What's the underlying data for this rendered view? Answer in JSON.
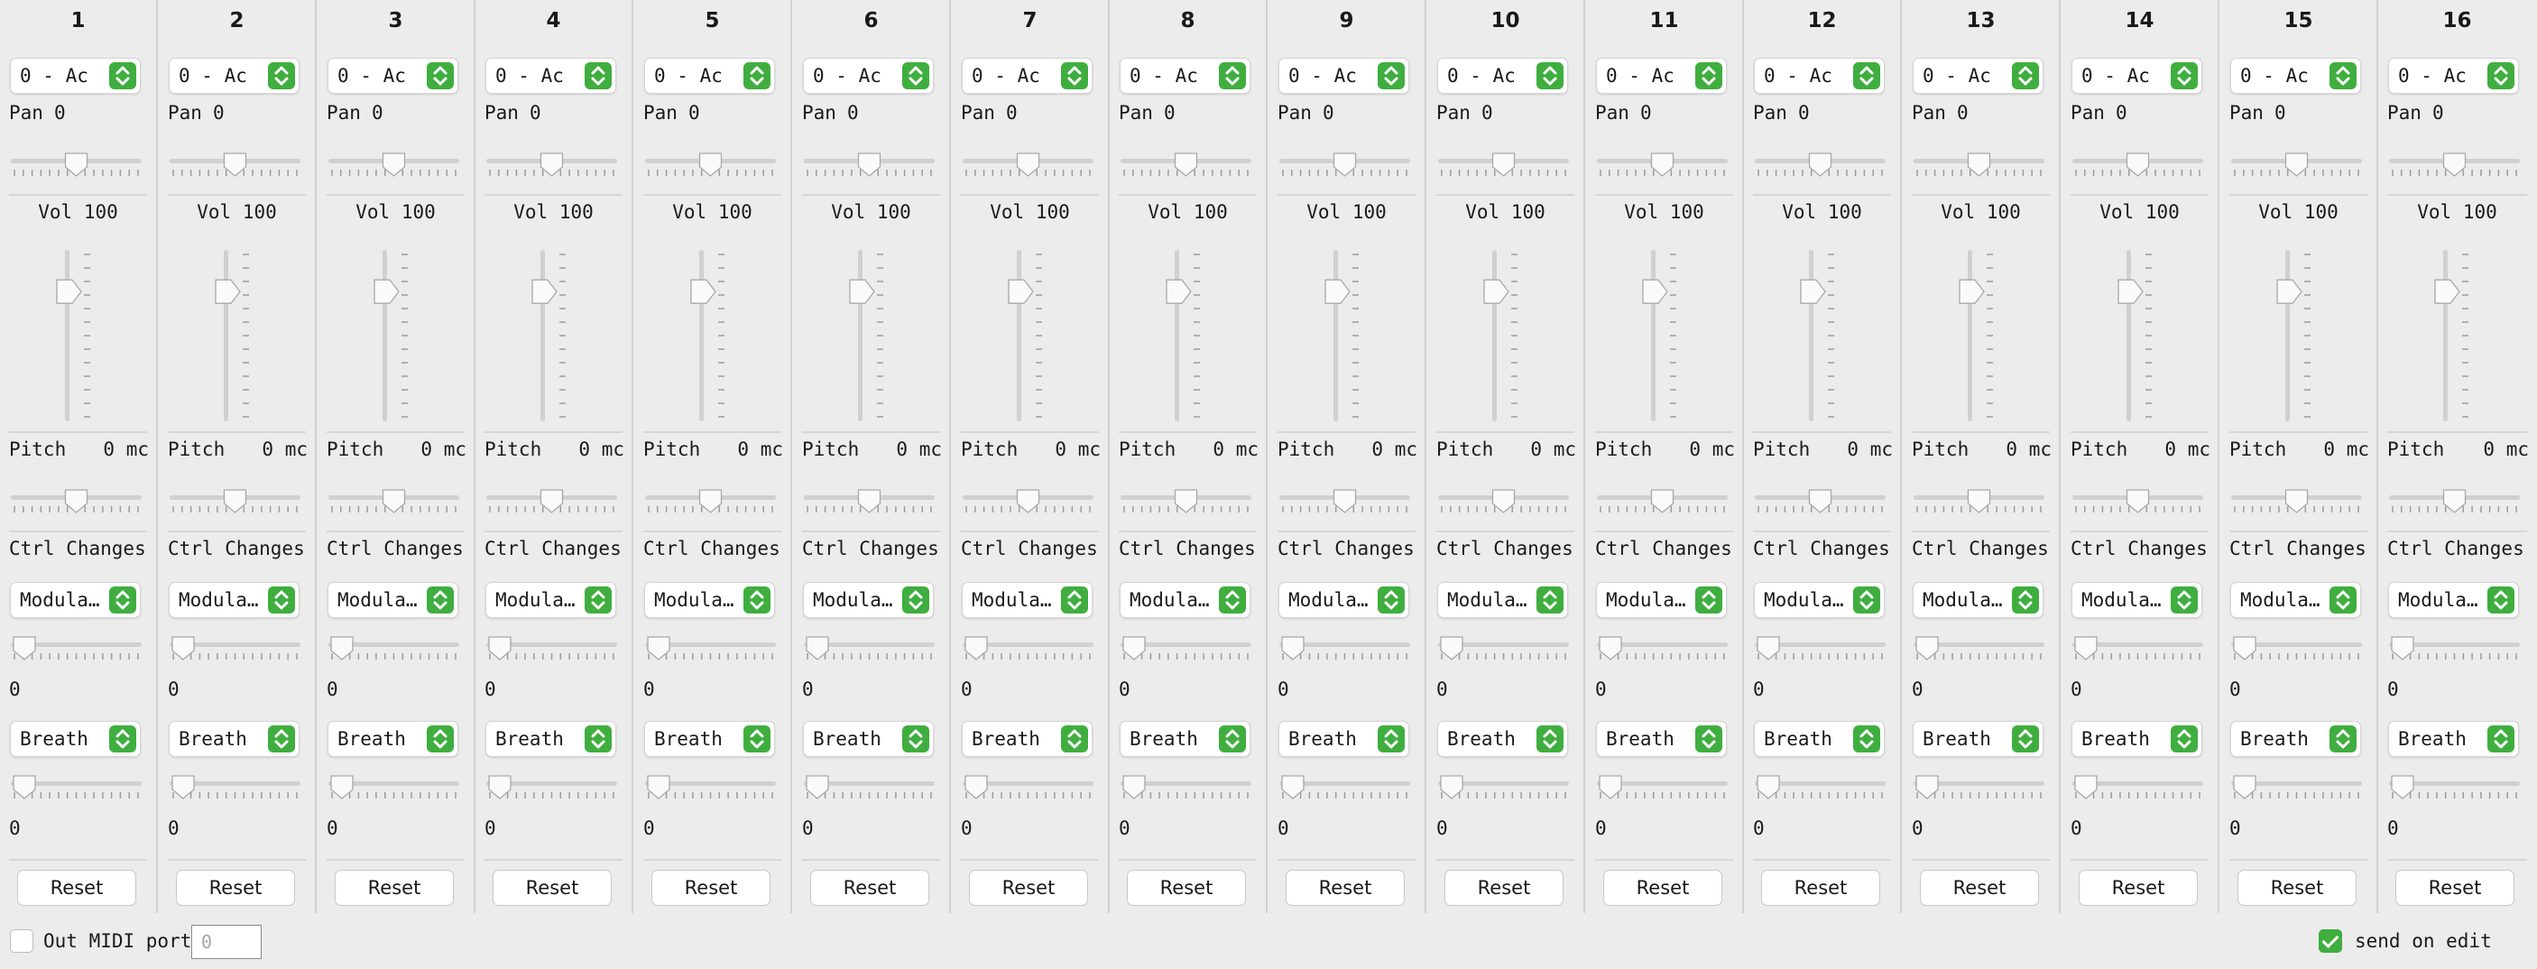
{
  "channels": [
    {
      "number": "1",
      "program": "0 - Ac",
      "pan_label": "Pan",
      "pan_value": "0",
      "pan_level": 0.5,
      "vol_label": "Vol",
      "vol_value": "100",
      "vol_level": 0.787,
      "pitch_label": "Pitch",
      "pitch_value": "0 mc",
      "pitch_level": 0.5,
      "ctrl_label": "Ctrl Changes",
      "ctrl1_name": "Modulation",
      "ctrl1_value": "0",
      "ctrl1_level": 0,
      "ctrl2_name": "Breath",
      "ctrl2_value": "0",
      "ctrl2_level": 0,
      "reset_label": "Reset"
    },
    {
      "number": "2",
      "program": "0 - Ac",
      "pan_label": "Pan",
      "pan_value": "0",
      "pan_level": 0.5,
      "vol_label": "Vol",
      "vol_value": "100",
      "vol_level": 0.787,
      "pitch_label": "Pitch",
      "pitch_value": "0 mc",
      "pitch_level": 0.5,
      "ctrl_label": "Ctrl Changes",
      "ctrl1_name": "Modulation",
      "ctrl1_value": "0",
      "ctrl1_level": 0,
      "ctrl2_name": "Breath",
      "ctrl2_value": "0",
      "ctrl2_level": 0,
      "reset_label": "Reset"
    },
    {
      "number": "3",
      "program": "0 - Ac",
      "pan_label": "Pan",
      "pan_value": "0",
      "pan_level": 0.5,
      "vol_label": "Vol",
      "vol_value": "100",
      "vol_level": 0.787,
      "pitch_label": "Pitch",
      "pitch_value": "0 mc",
      "pitch_level": 0.5,
      "ctrl_label": "Ctrl Changes",
      "ctrl1_name": "Modulation",
      "ctrl1_value": "0",
      "ctrl1_level": 0,
      "ctrl2_name": "Breath",
      "ctrl2_value": "0",
      "ctrl2_level": 0,
      "reset_label": "Reset"
    },
    {
      "number": "4",
      "program": "0 - Ac",
      "pan_label": "Pan",
      "pan_value": "0",
      "pan_level": 0.5,
      "vol_label": "Vol",
      "vol_value": "100",
      "vol_level": 0.787,
      "pitch_label": "Pitch",
      "pitch_value": "0 mc",
      "pitch_level": 0.5,
      "ctrl_label": "Ctrl Changes",
      "ctrl1_name": "Modulation",
      "ctrl1_value": "0",
      "ctrl1_level": 0,
      "ctrl2_name": "Breath",
      "ctrl2_value": "0",
      "ctrl2_level": 0,
      "reset_label": "Reset"
    },
    {
      "number": "5",
      "program": "0 - Ac",
      "pan_label": "Pan",
      "pan_value": "0",
      "pan_level": 0.5,
      "vol_label": "Vol",
      "vol_value": "100",
      "vol_level": 0.787,
      "pitch_label": "Pitch",
      "pitch_value": "0 mc",
      "pitch_level": 0.5,
      "ctrl_label": "Ctrl Changes",
      "ctrl1_name": "Modulation",
      "ctrl1_value": "0",
      "ctrl1_level": 0,
      "ctrl2_name": "Breath",
      "ctrl2_value": "0",
      "ctrl2_level": 0,
      "reset_label": "Reset"
    },
    {
      "number": "6",
      "program": "0 - Ac",
      "pan_label": "Pan",
      "pan_value": "0",
      "pan_level": 0.5,
      "vol_label": "Vol",
      "vol_value": "100",
      "vol_level": 0.787,
      "pitch_label": "Pitch",
      "pitch_value": "0 mc",
      "pitch_level": 0.5,
      "ctrl_label": "Ctrl Changes",
      "ctrl1_name": "Modulation",
      "ctrl1_value": "0",
      "ctrl1_level": 0,
      "ctrl2_name": "Breath",
      "ctrl2_value": "0",
      "ctrl2_level": 0,
      "reset_label": "Reset"
    },
    {
      "number": "7",
      "program": "0 - Ac",
      "pan_label": "Pan",
      "pan_value": "0",
      "pan_level": 0.5,
      "vol_label": "Vol",
      "vol_value": "100",
      "vol_level": 0.787,
      "pitch_label": "Pitch",
      "pitch_value": "0 mc",
      "pitch_level": 0.5,
      "ctrl_label": "Ctrl Changes",
      "ctrl1_name": "Modulation",
      "ctrl1_value": "0",
      "ctrl1_level": 0,
      "ctrl2_name": "Breath",
      "ctrl2_value": "0",
      "ctrl2_level": 0,
      "reset_label": "Reset"
    },
    {
      "number": "8",
      "program": "0 - Ac",
      "pan_label": "Pan",
      "pan_value": "0",
      "pan_level": 0.5,
      "vol_label": "Vol",
      "vol_value": "100",
      "vol_level": 0.787,
      "pitch_label": "Pitch",
      "pitch_value": "0 mc",
      "pitch_level": 0.5,
      "ctrl_label": "Ctrl Changes",
      "ctrl1_name": "Modulation",
      "ctrl1_value": "0",
      "ctrl1_level": 0,
      "ctrl2_name": "Breath",
      "ctrl2_value": "0",
      "ctrl2_level": 0,
      "reset_label": "Reset"
    },
    {
      "number": "9",
      "program": "0 - Ac",
      "pan_label": "Pan",
      "pan_value": "0",
      "pan_level": 0.5,
      "vol_label": "Vol",
      "vol_value": "100",
      "vol_level": 0.787,
      "pitch_label": "Pitch",
      "pitch_value": "0 mc",
      "pitch_level": 0.5,
      "ctrl_label": "Ctrl Changes",
      "ctrl1_name": "Modulation",
      "ctrl1_value": "0",
      "ctrl1_level": 0,
      "ctrl2_name": "Breath",
      "ctrl2_value": "0",
      "ctrl2_level": 0,
      "reset_label": "Reset"
    },
    {
      "number": "10",
      "program": "0 - Ac",
      "pan_label": "Pan",
      "pan_value": "0",
      "pan_level": 0.5,
      "vol_label": "Vol",
      "vol_value": "100",
      "vol_level": 0.787,
      "pitch_label": "Pitch",
      "pitch_value": "0 mc",
      "pitch_level": 0.5,
      "ctrl_label": "Ctrl Changes",
      "ctrl1_name": "Modulation",
      "ctrl1_value": "0",
      "ctrl1_level": 0,
      "ctrl2_name": "Breath",
      "ctrl2_value": "0",
      "ctrl2_level": 0,
      "reset_label": "Reset"
    },
    {
      "number": "11",
      "program": "0 - Ac",
      "pan_label": "Pan",
      "pan_value": "0",
      "pan_level": 0.5,
      "vol_label": "Vol",
      "vol_value": "100",
      "vol_level": 0.787,
      "pitch_label": "Pitch",
      "pitch_value": "0 mc",
      "pitch_level": 0.5,
      "ctrl_label": "Ctrl Changes",
      "ctrl1_name": "Modulation",
      "ctrl1_value": "0",
      "ctrl1_level": 0,
      "ctrl2_name": "Breath",
      "ctrl2_value": "0",
      "ctrl2_level": 0,
      "reset_label": "Reset"
    },
    {
      "number": "12",
      "program": "0 - Ac",
      "pan_label": "Pan",
      "pan_value": "0",
      "pan_level": 0.5,
      "vol_label": "Vol",
      "vol_value": "100",
      "vol_level": 0.787,
      "pitch_label": "Pitch",
      "pitch_value": "0 mc",
      "pitch_level": 0.5,
      "ctrl_label": "Ctrl Changes",
      "ctrl1_name": "Modulation",
      "ctrl1_value": "0",
      "ctrl1_level": 0,
      "ctrl2_name": "Breath",
      "ctrl2_value": "0",
      "ctrl2_level": 0,
      "reset_label": "Reset"
    },
    {
      "number": "13",
      "program": "0 - Ac",
      "pan_label": "Pan",
      "pan_value": "0",
      "pan_level": 0.5,
      "vol_label": "Vol",
      "vol_value": "100",
      "vol_level": 0.787,
      "pitch_label": "Pitch",
      "pitch_value": "0 mc",
      "pitch_level": 0.5,
      "ctrl_label": "Ctrl Changes",
      "ctrl1_name": "Modulation",
      "ctrl1_value": "0",
      "ctrl1_level": 0,
      "ctrl2_name": "Breath",
      "ctrl2_value": "0",
      "ctrl2_level": 0,
      "reset_label": "Reset"
    },
    {
      "number": "14",
      "program": "0 - Ac",
      "pan_label": "Pan",
      "pan_value": "0",
      "pan_level": 0.5,
      "vol_label": "Vol",
      "vol_value": "100",
      "vol_level": 0.787,
      "pitch_label": "Pitch",
      "pitch_value": "0 mc",
      "pitch_level": 0.5,
      "ctrl_label": "Ctrl Changes",
      "ctrl1_name": "Modulation",
      "ctrl1_value": "0",
      "ctrl1_level": 0,
      "ctrl2_name": "Breath",
      "ctrl2_value": "0",
      "ctrl2_level": 0,
      "reset_label": "Reset"
    },
    {
      "number": "15",
      "program": "0 - Ac",
      "pan_label": "Pan",
      "pan_value": "0",
      "pan_level": 0.5,
      "vol_label": "Vol",
      "vol_value": "100",
      "vol_level": 0.787,
      "pitch_label": "Pitch",
      "pitch_value": "0 mc",
      "pitch_level": 0.5,
      "ctrl_label": "Ctrl Changes",
      "ctrl1_name": "Modulation",
      "ctrl1_value": "0",
      "ctrl1_level": 0,
      "ctrl2_name": "Breath",
      "ctrl2_value": "0",
      "ctrl2_level": 0,
      "reset_label": "Reset"
    },
    {
      "number": "16",
      "program": "0 - Ac",
      "pan_label": "Pan",
      "pan_value": "0",
      "pan_level": 0.5,
      "vol_label": "Vol",
      "vol_value": "100",
      "vol_level": 0.787,
      "pitch_label": "Pitch",
      "pitch_value": "0 mc",
      "pitch_level": 0.5,
      "ctrl_label": "Ctrl Changes",
      "ctrl1_name": "Modulation",
      "ctrl1_value": "0",
      "ctrl1_level": 0,
      "ctrl2_name": "Breath",
      "ctrl2_value": "0",
      "ctrl2_level": 0,
      "reset_label": "Reset"
    }
  ],
  "footer": {
    "out_midi_label": "Out MIDI port",
    "out_midi_checked": false,
    "port_placeholder": "0",
    "port_value": "",
    "send_on_edit_label": "send on edit",
    "send_on_edit_checked": true
  },
  "icons": {
    "select_stepper": "up-down-chevron-icon",
    "checkmark": "checkmark-icon"
  },
  "colors": {
    "accent": "#3fae3f",
    "background": "#ececec",
    "separator": "#d6d6d6",
    "track": "#d0d0d0"
  }
}
